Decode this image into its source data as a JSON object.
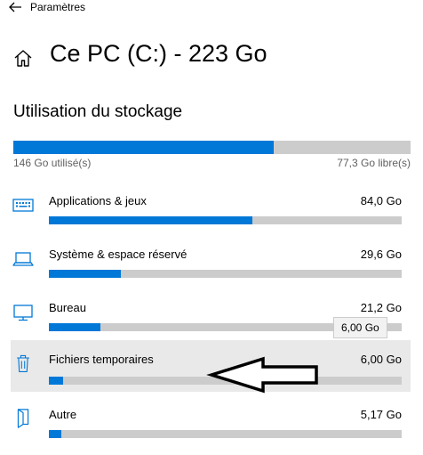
{
  "app": {
    "title": "Paramètres"
  },
  "page": {
    "title": "Ce PC (C:) - 223 Go"
  },
  "storage": {
    "section_title": "Utilisation du stockage",
    "used_label": "146 Go utilisé(s)",
    "free_label": "77,3 Go libre(s)",
    "used_fraction": 0.655
  },
  "categories": [
    {
      "name": "Applications & jeux",
      "size": "84,0 Go",
      "fraction": 0.578,
      "icon": "keyboard-icon"
    },
    {
      "name": "Système & espace réservé",
      "size": "29,6 Go",
      "fraction": 0.204,
      "icon": "laptop-icon"
    },
    {
      "name": "Bureau",
      "size": "21,2 Go",
      "fraction": 0.146,
      "icon": "monitor-icon"
    },
    {
      "name": "Fichiers temporaires",
      "size": "6,00 Go",
      "fraction": 0.041,
      "icon": "trash-icon"
    },
    {
      "name": "Autre",
      "size": "5,17 Go",
      "fraction": 0.036,
      "icon": "document-icon"
    }
  ],
  "tooltip": {
    "text": "6,00 Go"
  },
  "colors": {
    "accent": "#0078d7",
    "bar_track": "#cccccc",
    "hover_bg": "#e9e9e9",
    "secondary_text": "#606060"
  }
}
